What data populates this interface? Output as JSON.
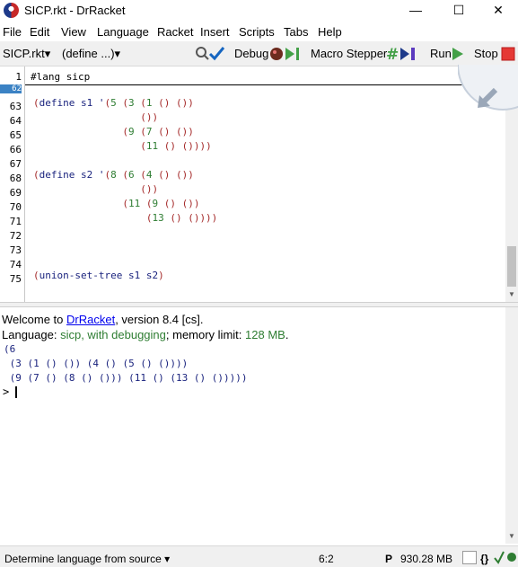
{
  "window": {
    "title": "SICP.rkt - DrRacket",
    "minimize_glyph": "—",
    "maximize_glyph": "☐",
    "close_glyph": "✕"
  },
  "menu": {
    "items": [
      "File",
      "Edit",
      "View",
      "Language",
      "Racket",
      "Insert",
      "Scripts",
      "Tabs",
      "Help"
    ]
  },
  "toolbar": {
    "file_menu": "SICP.rkt▾",
    "define_menu": "(define ...)▾",
    "debug_label": "Debug",
    "macro_stepper_label": "Macro Stepper",
    "run_label": "Run",
    "stop_label": "Stop"
  },
  "editor": {
    "header_line_number": "1",
    "header_code": "#lang sicp",
    "line_numbers": [
      "62",
      "63",
      "64",
      "65",
      "66",
      "67",
      "68",
      "69",
      "70",
      "71",
      "72",
      "73",
      "74",
      "75"
    ],
    "highlighted_line": "62",
    "code": [
      {
        "segments": [
          [
            "p",
            "("
          ],
          [
            "i",
            "define s1 '"
          ],
          [
            "p",
            "("
          ],
          [
            "n",
            "5"
          ],
          [
            "p",
            " ("
          ],
          [
            "n",
            "3"
          ],
          [
            "p",
            " ("
          ],
          [
            "n",
            "1"
          ],
          [
            "p",
            " () ())"
          ]
        ]
      },
      {
        "segments": [
          [
            "p",
            "                  ())"
          ]
        ]
      },
      {
        "segments": [
          [
            "p",
            "               ("
          ],
          [
            "n",
            "9"
          ],
          [
            "p",
            " ("
          ],
          [
            "n",
            "7"
          ],
          [
            "p",
            " () ())"
          ]
        ]
      },
      {
        "segments": [
          [
            "p",
            "                  ("
          ],
          [
            "n",
            "11"
          ],
          [
            "p",
            " () ())))"
          ]
        ]
      },
      {
        "segments": []
      },
      {
        "segments": [
          [
            "p",
            "("
          ],
          [
            "i",
            "define s2 '"
          ],
          [
            "p",
            "("
          ],
          [
            "n",
            "8"
          ],
          [
            "p",
            " ("
          ],
          [
            "n",
            "6"
          ],
          [
            "p",
            " ("
          ],
          [
            "n",
            "4"
          ],
          [
            "p",
            " () ())"
          ]
        ]
      },
      {
        "segments": [
          [
            "p",
            "                  ())"
          ]
        ]
      },
      {
        "segments": [
          [
            "p",
            "               ("
          ],
          [
            "n",
            "11"
          ],
          [
            "p",
            " ("
          ],
          [
            "n",
            "9"
          ],
          [
            "p",
            " () ())"
          ]
        ]
      },
      {
        "segments": [
          [
            "p",
            "                   ("
          ],
          [
            "n",
            "13"
          ],
          [
            "p",
            " () ())))"
          ]
        ]
      },
      {
        "segments": []
      },
      {
        "segments": []
      },
      {
        "segments": []
      },
      {
        "segments": [
          [
            "p",
            "("
          ],
          [
            "i",
            "union-set-tree s1 s2"
          ],
          [
            "p",
            ")"
          ]
        ]
      }
    ]
  },
  "repl": {
    "welcome_prefix": "Welcome to ",
    "welcome_link": "DrRacket",
    "welcome_suffix": ", version 8.4 [cs].",
    "language_prefix": "Language: ",
    "language_name": "sicp, with debugging",
    "memory_prefix": "; memory limit: ",
    "memory_value": "128 MB",
    "memory_suffix": ".",
    "output": [
      "(6",
      " (3 (1 () ()) (4 () (5 () ())))",
      " (9 (7 () (8 () ())) (11 () (13 () ()))))"
    ],
    "prompt": ">"
  },
  "status": {
    "language_selector": "Determine language from source ▾",
    "position": "6:2",
    "p_label": "P",
    "memory": "930.28 MB",
    "braces": "{}"
  },
  "colors": {
    "paren": "#a52a2a",
    "number": "#2e7d32",
    "identifier": "#1a237e",
    "link": "#0000ee",
    "language_green": "#2e7d32",
    "line_highlight": "#3b82c4",
    "stop_red": "#e53935",
    "run_green": "#43a047"
  }
}
